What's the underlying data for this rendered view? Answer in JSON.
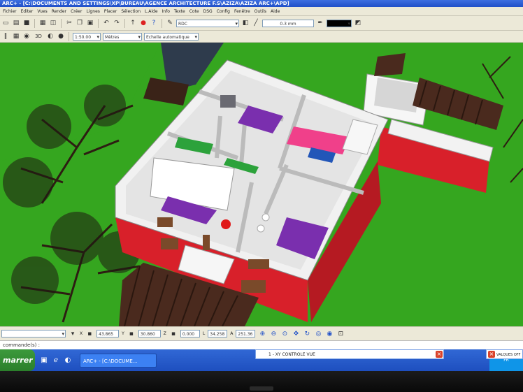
{
  "titlebar": {
    "title": "ARC+ - [C:\\DOCUMENTS AND SETTINGS\\XP\\BUREAU\\AGENCE ARCHITECTURE F.S\\AZIZA\\AZIZA ARC+\\APD]"
  },
  "menu": [
    "Fichier",
    "Editer",
    "Vues",
    "Render",
    "Créer",
    "Lignes",
    "Placer",
    "Sélection",
    "L.Aide",
    "Info",
    "Texte",
    "Cote",
    "DSG",
    "Config",
    "Fenêtre",
    "Outils",
    "Aide"
  ],
  "toolbar": {
    "layer_value": "RDC",
    "linewidth_value": "0.3 mm",
    "scale_value": "1:50.00",
    "units_value": "Mètres",
    "zoom_value": "Echelle automatique",
    "view3d_label": "3D"
  },
  "coords": {
    "x_label": "X",
    "x_value": "43.865",
    "y_label": "Y",
    "y_value": "30.860",
    "z_label": "Z",
    "z_value": "0.000",
    "l_label": "L",
    "l_value": "34.258",
    "a_label": "A",
    "a_value": "251.36"
  },
  "command": {
    "text": "commande(s) :"
  },
  "taskbar": {
    "start_label": "marrer",
    "task_label": "ARC+ - [C:\\DOCUME...",
    "popup1_text": "1 - XY CONTROLE VUE",
    "popup2_text": "VALQUES OFF",
    "tray_text": "FR"
  },
  "colors": {
    "grass": "#35a61f",
    "red_base": "#d8202a",
    "wall": "#f1f1f1",
    "purple": "#7a2fae",
    "pink": "#f0408a",
    "wood": "#4a2a1e"
  }
}
